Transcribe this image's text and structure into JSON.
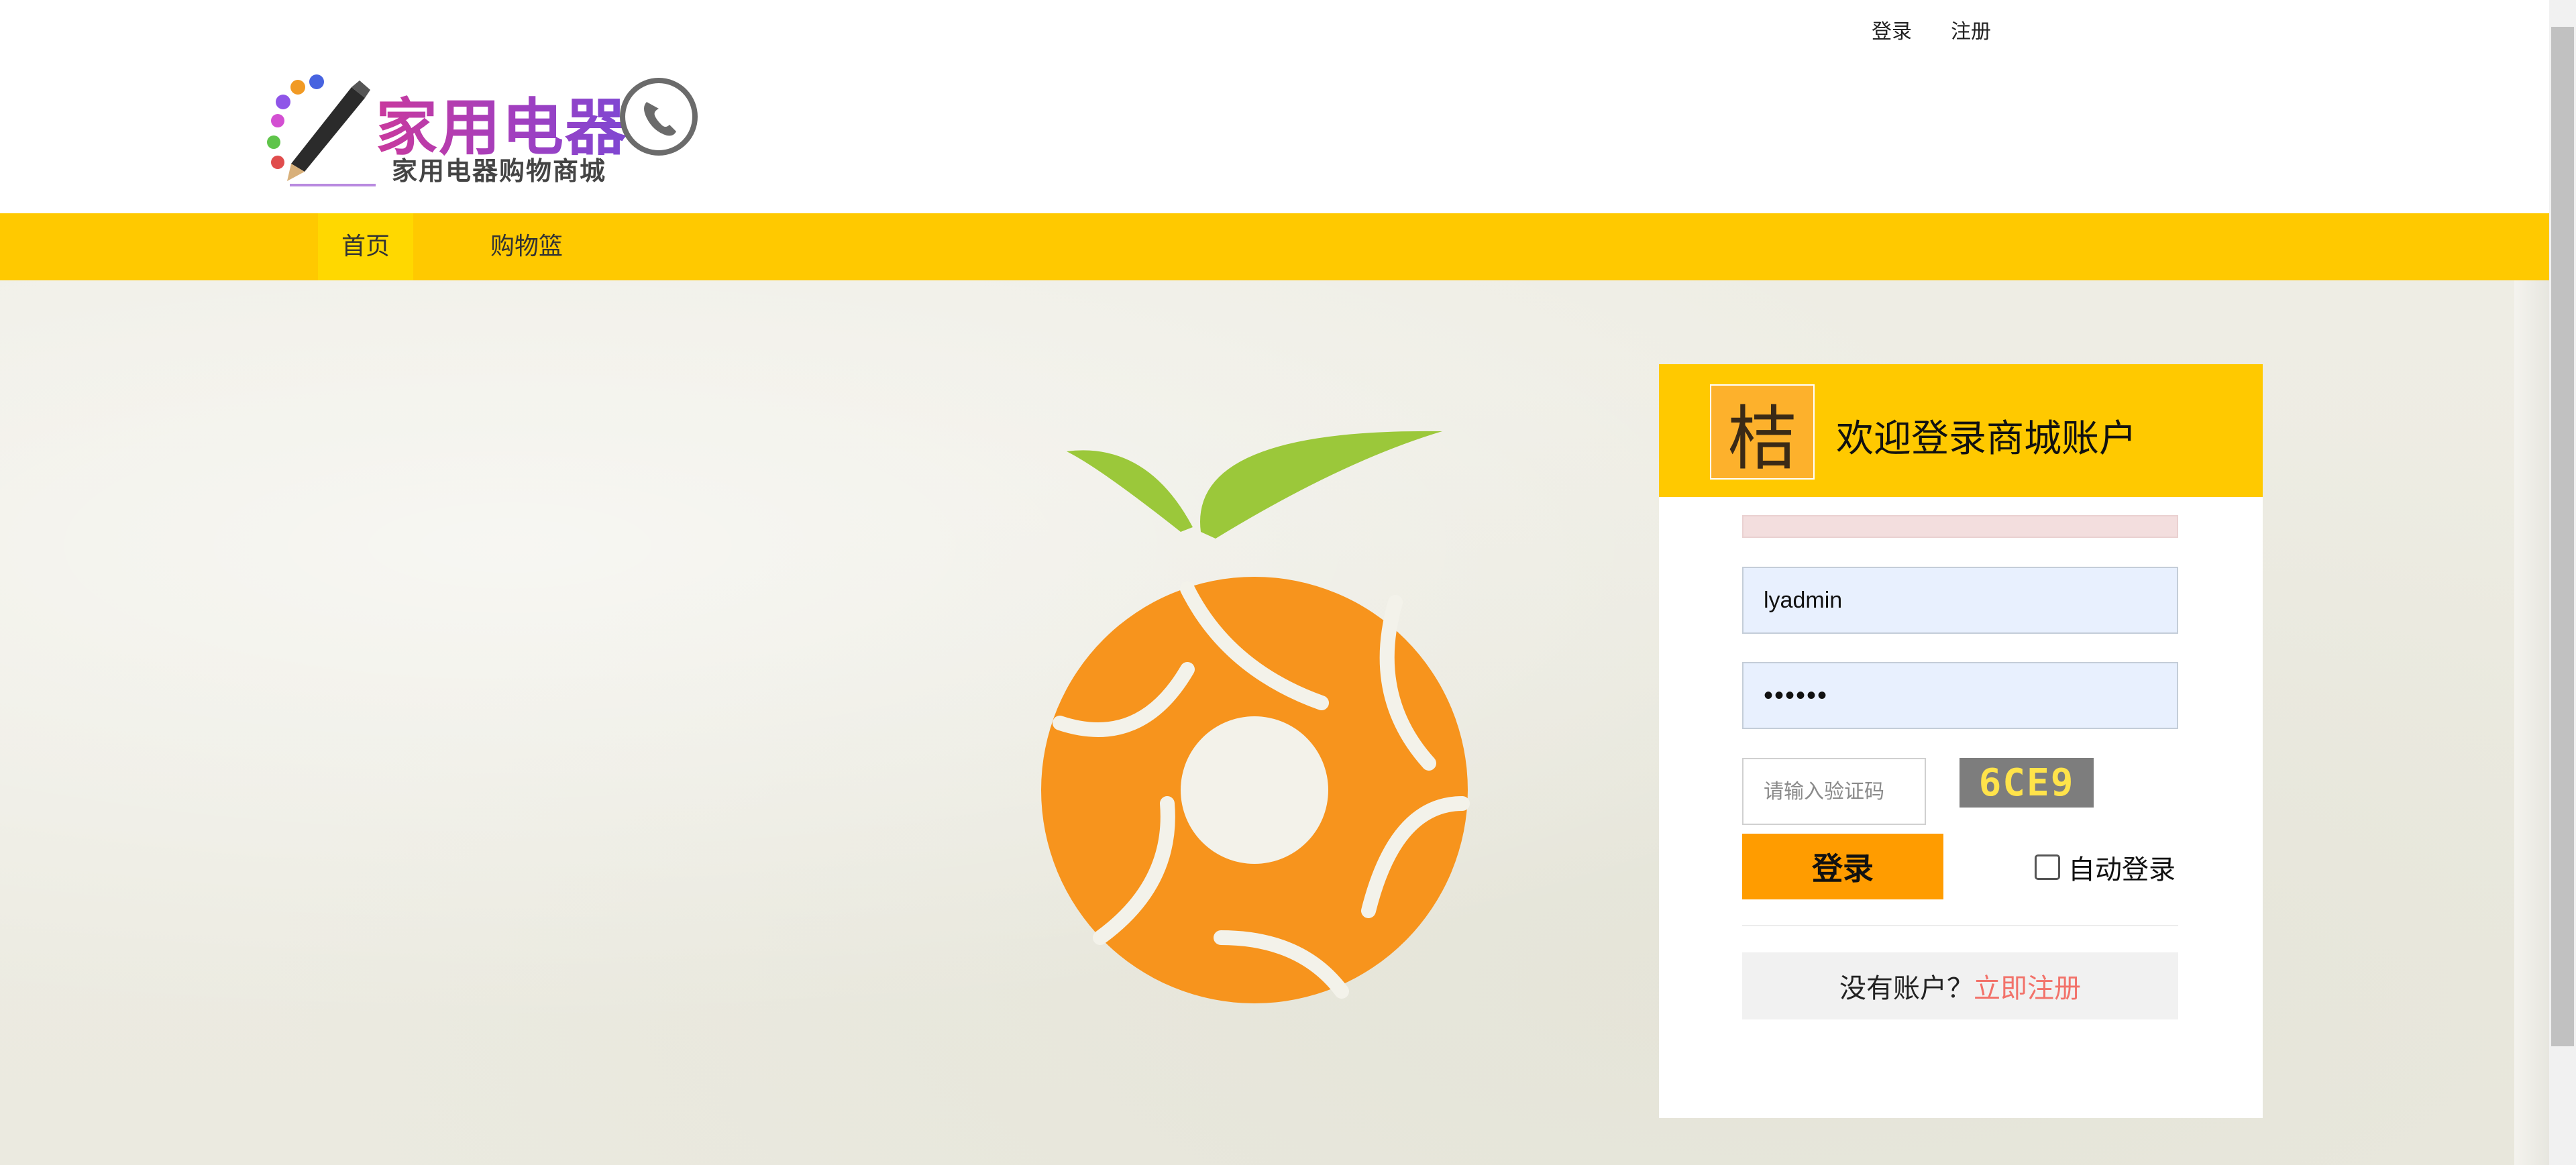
{
  "top_links": {
    "login": "登录",
    "register": "注册"
  },
  "logo": {
    "title": "家用电器",
    "subtitle": "家用电器购物商城"
  },
  "nav": {
    "home": "首页",
    "cart": "购物篮"
  },
  "login_card": {
    "logo_char": "桔",
    "title": "欢迎登录商城账户",
    "username_value": "lyadmin",
    "password_value": "••••••",
    "captcha_placeholder": "请输入验证码",
    "captcha_code": "6CE9",
    "login_button": "登录",
    "auto_login_label": "自动登录",
    "no_account_text": "没有账户？",
    "register_link": "立即注册"
  },
  "colors": {
    "nav_bar": "#ffc900",
    "nav_active": "#ffd800",
    "login_button": "#ff9c00",
    "register_link": "#f2726a",
    "brand_orange": "#f7941d",
    "leaf_green": "#9bc83a"
  }
}
